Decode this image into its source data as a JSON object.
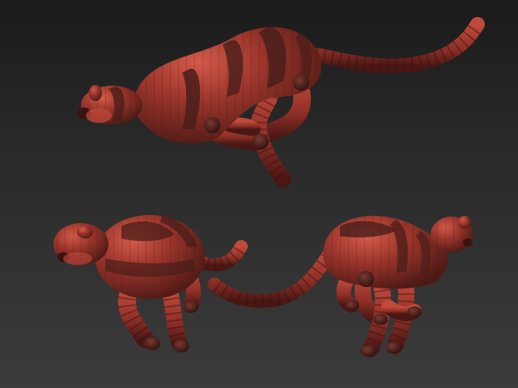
{
  "scene": {
    "subject": "sculpted-cheetah-models",
    "model_count": 3,
    "colors": {
      "background_top": "#1b1b1b",
      "background_bottom": "#3b3b3b",
      "material_base": "#8a2e26",
      "material_highlight": "#c4483b",
      "material_stripe": "#4a1e1a"
    }
  }
}
